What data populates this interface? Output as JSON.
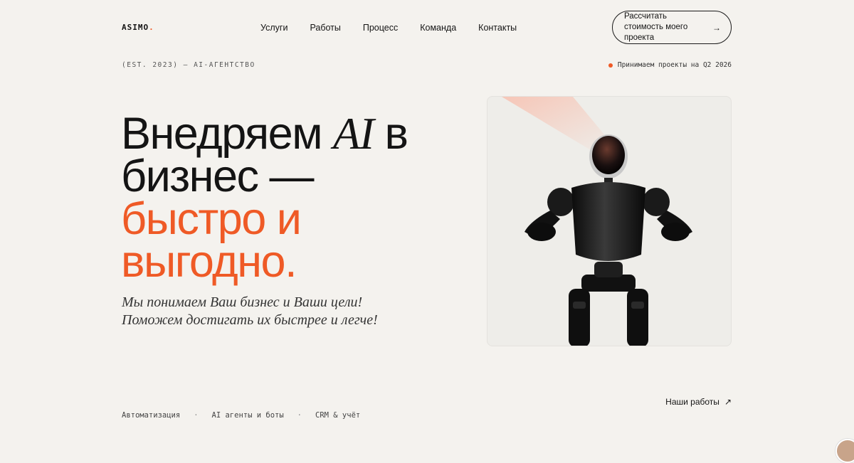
{
  "header": {
    "logo_text": "ASIMO",
    "logo_dot": ".",
    "nav": [
      {
        "label": "Услуги"
      },
      {
        "label": "Работы"
      },
      {
        "label": "Процесс"
      },
      {
        "label": "Команда"
      },
      {
        "label": "Контакты"
      }
    ],
    "cta_label": "Рассчитать стоимость моего проекта",
    "cta_arrow": "→"
  },
  "meta": {
    "est": "(EST. 2023) — AI-АГЕНТСТВО",
    "status": "Принимаем проекты на Q2 2026"
  },
  "hero": {
    "line1_a": "Внедряем ",
    "line1_ai": "AI",
    "line1_b": " в",
    "line2": "бизнес —",
    "line3": "быстро и",
    "line4": "выгодно.",
    "sub1": "Мы понимаем Ваш бизнес и Ваши цели!",
    "sub2": "Поможем достигать их быстрее и легче!"
  },
  "tags": [
    "Автоматизация",
    "AI агенты и боты",
    "CRM & учёт"
  ],
  "tag_sep": "·",
  "works_link": "Наши работы",
  "works_arrow": "↗",
  "colors": {
    "accent": "#ef5a26",
    "background": "#f4f2ee",
    "text": "#141414"
  },
  "image": {
    "subject": "robot-illustration"
  }
}
